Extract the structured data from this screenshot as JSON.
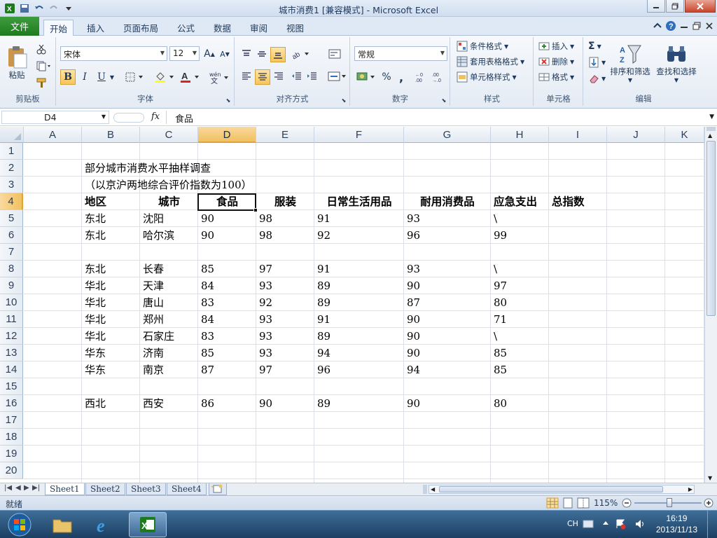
{
  "window": {
    "title": "城市消费1  [兼容模式] - Microsoft Excel"
  },
  "ribbon_tabs": [
    {
      "label": "文件"
    },
    {
      "label": "开始"
    },
    {
      "label": "插入"
    },
    {
      "label": "页面布局"
    },
    {
      "label": "公式"
    },
    {
      "label": "数据"
    },
    {
      "label": "审阅"
    },
    {
      "label": "视图"
    }
  ],
  "ribbon": {
    "clipboard": {
      "paste": "粘贴",
      "label": "剪贴板"
    },
    "font": {
      "name": "宋体",
      "size": "12",
      "label": "字体",
      "bold": "B",
      "italic": "I",
      "underline": "U"
    },
    "alignment": {
      "label": "对齐方式"
    },
    "number": {
      "format": "常规",
      "label": "数字",
      "percent": "%",
      "comma": ","
    },
    "styles": {
      "conditional": "条件格式",
      "table": "套用表格格式",
      "cell": "单元格样式",
      "label": "样式"
    },
    "cells": {
      "insert": "插入",
      "delete": "删除",
      "format": "格式",
      "label": "单元格"
    },
    "editing": {
      "sort": "排序和筛选",
      "find": "查找和选择",
      "label": "编辑",
      "sigma": "Σ"
    }
  },
  "formula_bar": {
    "name_box": "D4",
    "fx": "fx",
    "content": "食品"
  },
  "columns": [
    "A",
    "B",
    "C",
    "D",
    "E",
    "F",
    "G",
    "H",
    "I",
    "J",
    "K"
  ],
  "rows": [
    "1",
    "2",
    "3",
    "4",
    "5",
    "6",
    "7",
    "8",
    "9",
    "10",
    "11",
    "12",
    "13",
    "14",
    "15",
    "16",
    "17",
    "18",
    "19",
    "20"
  ],
  "sheet": {
    "title1": "部分城市消费水平抽样调查",
    "title2": "（以京沪两地综合评价指数为100）",
    "headers": [
      "地区",
      "城市",
      "食品",
      "服装",
      "日常生活用品",
      "耐用消费品",
      "应急支出",
      "总指数"
    ],
    "data": [
      {
        "row": 5,
        "cells": [
          "东北",
          "沈阳",
          "90",
          "98",
          "91",
          "93",
          "\\"
        ]
      },
      {
        "row": 6,
        "cells": [
          "东北",
          "哈尔滨",
          "90",
          "98",
          "92",
          "96",
          "99"
        ]
      },
      {
        "row": 8,
        "cells": [
          "东北",
          "长春",
          "85",
          "97",
          "91",
          "93",
          "\\"
        ]
      },
      {
        "row": 9,
        "cells": [
          "华北",
          "天津",
          "84",
          "93",
          "89",
          "90",
          "97"
        ]
      },
      {
        "row": 10,
        "cells": [
          "华北",
          "唐山",
          "83",
          "92",
          "89",
          "87",
          "80"
        ]
      },
      {
        "row": 11,
        "cells": [
          "华北",
          "郑州",
          "84",
          "93",
          "91",
          "90",
          "71"
        ]
      },
      {
        "row": 12,
        "cells": [
          "华北",
          "石家庄",
          "83",
          "93",
          "89",
          "90",
          "\\"
        ]
      },
      {
        "row": 13,
        "cells": [
          "华东",
          "济南",
          "85",
          "93",
          "94",
          "90",
          "85"
        ]
      },
      {
        "row": 14,
        "cells": [
          "华东",
          "南京",
          "87",
          "97",
          "96",
          "94",
          "85"
        ]
      },
      {
        "row": 16,
        "cells": [
          "西北",
          "西安",
          "86",
          "90",
          "89",
          "90",
          "80"
        ]
      }
    ]
  },
  "sheet_tabs": [
    "Sheet1",
    "Sheet2",
    "Sheet3",
    "Sheet4"
  ],
  "status": {
    "ready": "就绪",
    "zoom": "115%"
  },
  "taskbar": {
    "ime": "CH",
    "time": "16:19",
    "date": "2013/11/13"
  },
  "colors": {
    "file_tab": "#2a8a2a",
    "selected_header": "#f5cd7a",
    "taskbar": "#2a5279"
  }
}
